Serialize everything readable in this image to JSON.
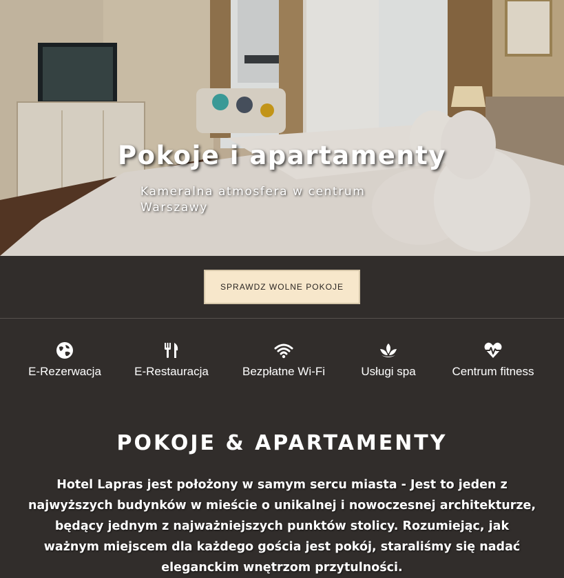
{
  "hero": {
    "title": "Pokoje i apartamenty",
    "subtitle": "Kameralna atmosfera w centrum Warszawy"
  },
  "cta": {
    "label": "SPRAWDZ WOLNE POKOJE"
  },
  "features": [
    {
      "label": "E-Rezerwacja",
      "icon": "globe-icon"
    },
    {
      "label": "E-Restauracja",
      "icon": "fork-knife-icon"
    },
    {
      "label": "Bezpłatne Wi-Fi",
      "icon": "wifi-icon"
    },
    {
      "label": "Usługi spa",
      "icon": "lotus-icon"
    },
    {
      "label": "Centrum fitness",
      "icon": "heartbeat-icon"
    }
  ],
  "about": {
    "title": "POKOJE & APARTAMENTY",
    "text": "Hotel Lapras jest położony w samym sercu miasta - Jest to jeden z najwyższych budynków w mieście o unikalnej i nowoczesnej architekturze, będący jednym z najważniejszych punktów stolicy. Rozumiejąc, jak ważnym miejscem dla każdego gościa jest pokój, staraliśmy się nadać eleganckim wnętrzom przytulności."
  },
  "colors": {
    "background": "#312d2b",
    "button_bg": "#f7e7cb",
    "text": "#ffffff"
  }
}
